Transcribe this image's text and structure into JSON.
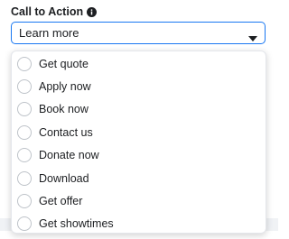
{
  "field": {
    "label": "Call to Action",
    "selected_value": "Learn more",
    "info_icon": "info-circle-icon",
    "chevron_icon": "caret-down-icon"
  },
  "dropdown": {
    "options": [
      {
        "label": "Get quote"
      },
      {
        "label": "Apply now"
      },
      {
        "label": "Book now"
      },
      {
        "label": "Contact us"
      },
      {
        "label": "Donate now"
      },
      {
        "label": "Download"
      },
      {
        "label": "Get offer"
      },
      {
        "label": "Get showtimes"
      }
    ]
  },
  "colors": {
    "accent": "#1877f2",
    "text": "#1c1e21",
    "radio_border": "#bec3c9"
  }
}
